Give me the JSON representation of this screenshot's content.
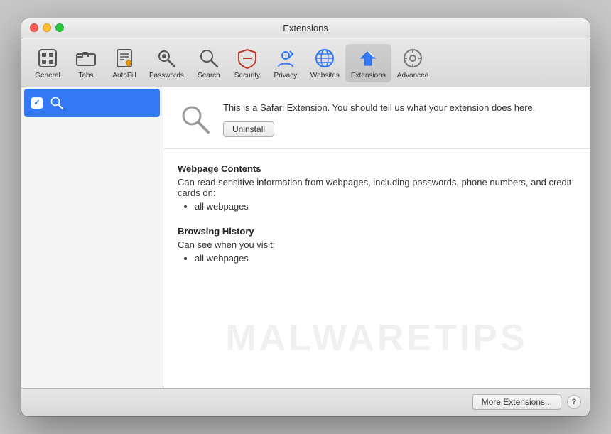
{
  "window": {
    "title": "Extensions"
  },
  "toolbar": {
    "items": [
      {
        "id": "general",
        "label": "General",
        "icon": "general"
      },
      {
        "id": "tabs",
        "label": "Tabs",
        "icon": "tabs"
      },
      {
        "id": "autofill",
        "label": "AutoFill",
        "icon": "autofill"
      },
      {
        "id": "passwords",
        "label": "Passwords",
        "icon": "passwords"
      },
      {
        "id": "search",
        "label": "Search",
        "icon": "search"
      },
      {
        "id": "security",
        "label": "Security",
        "icon": "security"
      },
      {
        "id": "privacy",
        "label": "Privacy",
        "icon": "privacy"
      },
      {
        "id": "websites",
        "label": "Websites",
        "icon": "websites"
      },
      {
        "id": "extensions",
        "label": "Extensions",
        "icon": "extensions",
        "active": true
      },
      {
        "id": "advanced",
        "label": "Advanced",
        "icon": "advanced"
      }
    ]
  },
  "sidebar": {
    "items": [
      {
        "id": "search-ext",
        "label": "",
        "enabled": true
      }
    ]
  },
  "extension": {
    "description": "This is a Safari Extension. You should tell us what your extension does here.",
    "uninstall_label": "Uninstall",
    "permissions": {
      "webpage_contents": {
        "title": "Webpage Contents",
        "description": "Can read sensitive information from webpages, including passwords, phone numbers, and credit cards on:",
        "items": [
          "all webpages"
        ]
      },
      "browsing_history": {
        "title": "Browsing History",
        "description": "Can see when you visit:",
        "items": [
          "all webpages"
        ]
      }
    }
  },
  "bottom_bar": {
    "more_extensions_label": "More Extensions...",
    "help_label": "?"
  },
  "watermark": {
    "text": "MALWARETIPS"
  }
}
